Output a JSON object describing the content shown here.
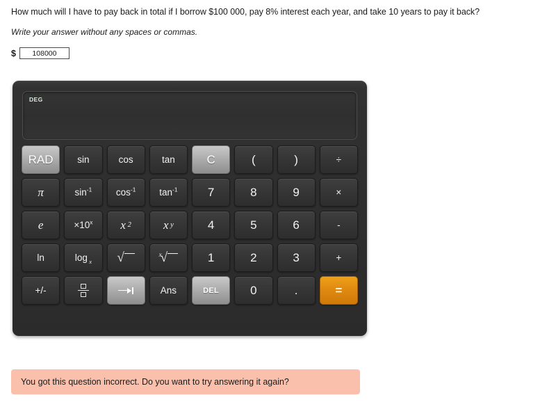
{
  "question": {
    "text": "How much will I have to pay back in total if I borrow $100 000, pay 8% interest each year, and take 10 years to pay it back?",
    "instruction": "Write your answer without any spaces or commas.",
    "currency_symbol": "$",
    "answer_value": "108000",
    "answer_placeholder": ""
  },
  "calculator": {
    "display": {
      "mode_indicator": "DEG",
      "value": ""
    },
    "keys": [
      {
        "label": "RAD",
        "name": "key-rad",
        "style": "light"
      },
      {
        "label": "sin",
        "name": "key-sin",
        "style": "small"
      },
      {
        "label": "cos",
        "name": "key-cos",
        "style": "small"
      },
      {
        "label": "tan",
        "name": "key-tan",
        "style": "small"
      },
      {
        "label": "C",
        "name": "key-clear",
        "style": "light"
      },
      {
        "label": "(",
        "name": "key-open-paren",
        "style": ""
      },
      {
        "label": ")",
        "name": "key-close-paren",
        "style": ""
      },
      {
        "label": "÷",
        "name": "key-divide",
        "style": "small"
      },
      {
        "label": "π",
        "name": "key-pi",
        "style": "mathit"
      },
      {
        "label": "sin-1",
        "name": "key-arcsin",
        "style": "small"
      },
      {
        "label": "cos-1",
        "name": "key-arccos",
        "style": "small"
      },
      {
        "label": "tan-1",
        "name": "key-arctan",
        "style": "small"
      },
      {
        "label": "7",
        "name": "key-7",
        "style": ""
      },
      {
        "label": "8",
        "name": "key-8",
        "style": ""
      },
      {
        "label": "9",
        "name": "key-9",
        "style": ""
      },
      {
        "label": "×",
        "name": "key-multiply",
        "style": "small"
      },
      {
        "label": "e",
        "name": "key-e",
        "style": "mathit"
      },
      {
        "label": "×10x",
        "name": "key-times-ten-power",
        "style": "small"
      },
      {
        "label": "x 2",
        "name": "key-square",
        "style": "mathit"
      },
      {
        "label": "x y",
        "name": "key-power",
        "style": "mathit"
      },
      {
        "label": "4",
        "name": "key-4",
        "style": ""
      },
      {
        "label": "5",
        "name": "key-5",
        "style": ""
      },
      {
        "label": "6",
        "name": "key-6",
        "style": ""
      },
      {
        "label": "-",
        "name": "key-subtract",
        "style": "small"
      },
      {
        "label": "ln",
        "name": "key-ln",
        "style": "small"
      },
      {
        "label": "log x",
        "name": "key-log-base",
        "style": "small"
      },
      {
        "label": "√",
        "name": "key-sqrt",
        "style": ""
      },
      {
        "label": "x√",
        "name": "key-nth-root",
        "style": ""
      },
      {
        "label": "1",
        "name": "key-1",
        "style": ""
      },
      {
        "label": "2",
        "name": "key-2",
        "style": ""
      },
      {
        "label": "3",
        "name": "key-3",
        "style": ""
      },
      {
        "label": "+",
        "name": "key-add",
        "style": "small"
      },
      {
        "label": "+/-",
        "name": "key-sign-toggle",
        "style": "small"
      },
      {
        "label": "fraction",
        "name": "key-fraction",
        "style": ""
      },
      {
        "label": "tab",
        "name": "key-tab",
        "style": "light"
      },
      {
        "label": "Ans",
        "name": "key-answer",
        "style": "small"
      },
      {
        "label": "DEL",
        "name": "key-delete",
        "style": "light tiny"
      },
      {
        "label": "0",
        "name": "key-0",
        "style": ""
      },
      {
        "label": ".",
        "name": "key-decimal",
        "style": ""
      },
      {
        "label": "=",
        "name": "key-equals",
        "style": "equals"
      }
    ]
  },
  "feedback": {
    "message": "You got this question incorrect. Do you want to try answering it again?",
    "background_color": "#fbc0ac"
  }
}
